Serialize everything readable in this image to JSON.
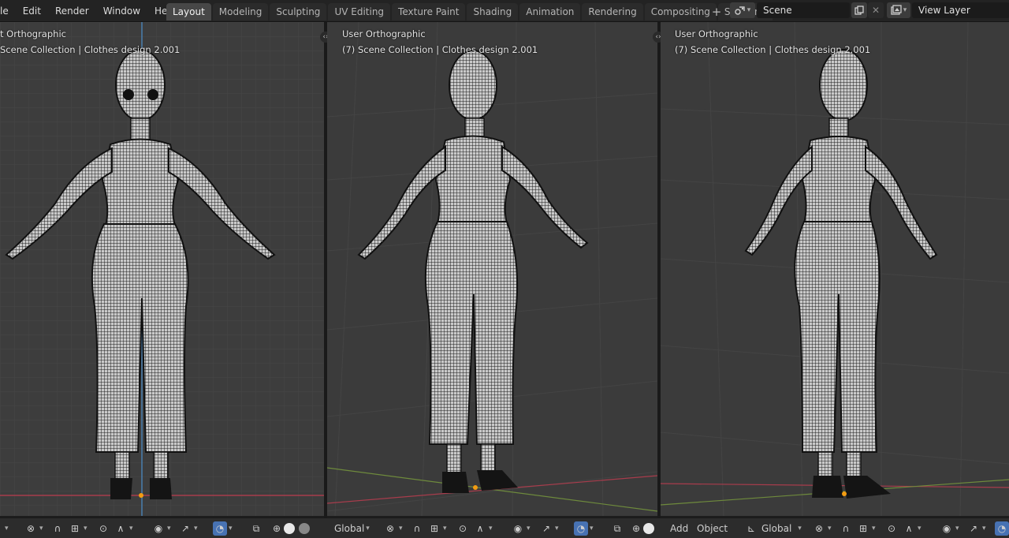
{
  "menu": {
    "items": [
      "le",
      "Edit",
      "Render",
      "Window",
      "Help"
    ]
  },
  "workspaces": {
    "tabs": [
      "Layout",
      "Modeling",
      "Sculpting",
      "UV Editing",
      "Texture Paint",
      "Shading",
      "Animation",
      "Rendering",
      "Compositing",
      "Scripting"
    ],
    "active": "Layout",
    "add_label": "+"
  },
  "scene": {
    "name": "Scene",
    "icon": "scene-icon"
  },
  "view_layer": {
    "name": "View Layer",
    "icon": "render-layers-icon"
  },
  "viewports": [
    {
      "title": "t Orthographic",
      "subtitle": "Scene Collection | Clothes design 2.001"
    },
    {
      "title": "User Orthographic",
      "subtitle": "(7) Scene Collection | Clothes design 2.001"
    },
    {
      "title": "User Orthographic",
      "subtitle": "(7) Scene Collection | Clothes design 2.001"
    }
  ],
  "header": {
    "orientation": "Global",
    "add_label": "Add",
    "object_label": "Object"
  },
  "colors": {
    "viewport_bg": "#3d3d3d",
    "grid_line": "#474747",
    "x_axis": "#a83c4c",
    "z_axis": "#4a7fae",
    "y_axis": "#6e8a3c",
    "active_tab": "#474747",
    "accent_blue": "#4772b3",
    "origin_dot": "#f39c12"
  }
}
